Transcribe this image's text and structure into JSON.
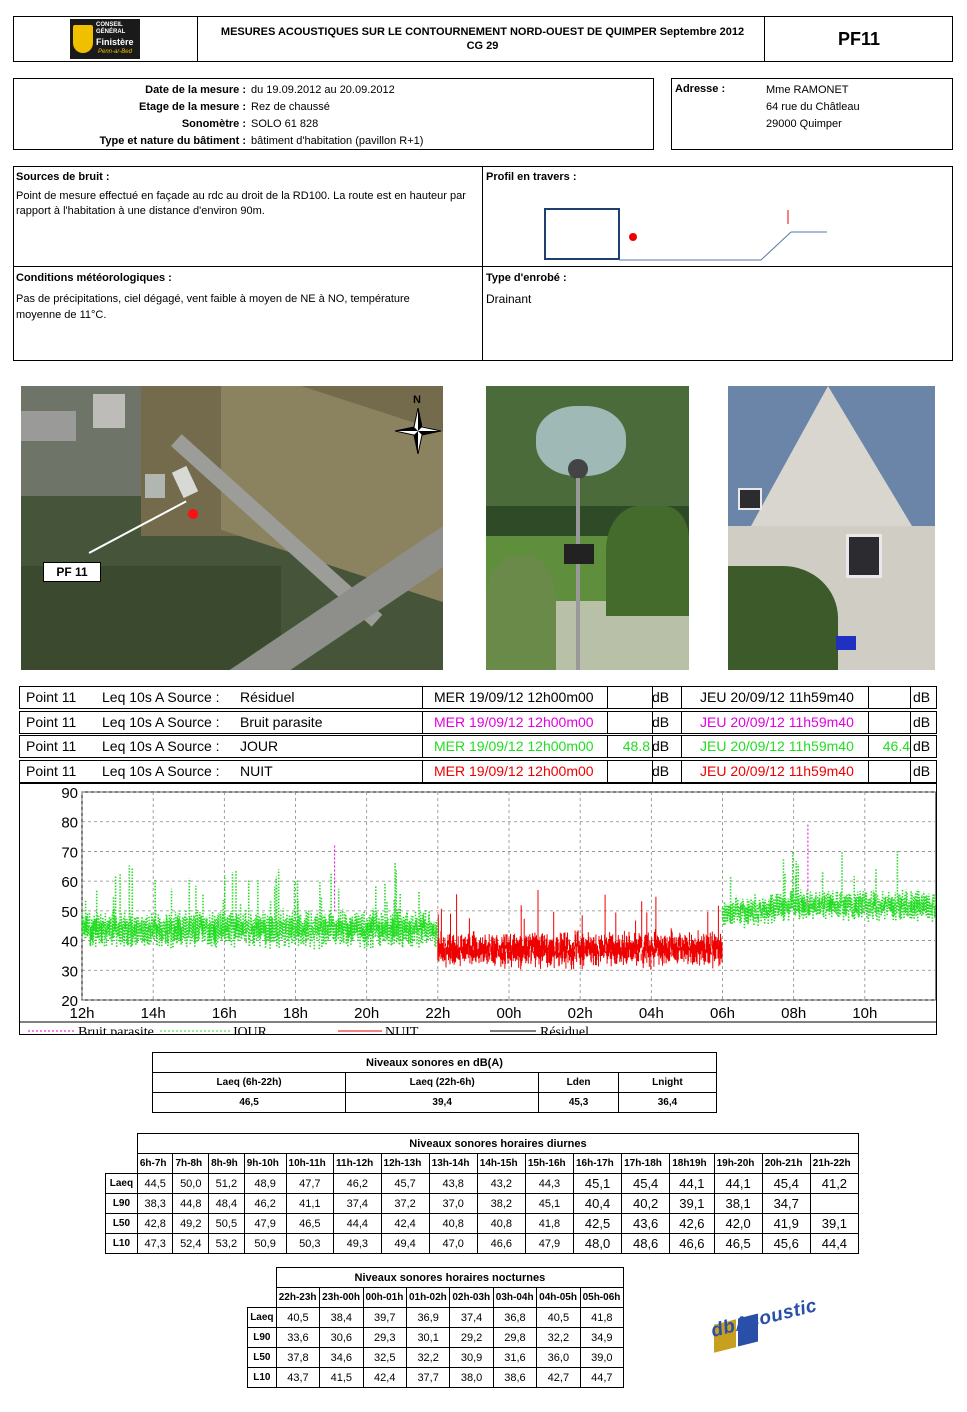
{
  "header": {
    "logo_lines": [
      "CONSEIL",
      "GÉNÉRAL",
      "Finistère",
      "Penn-ar-Bed"
    ],
    "title_line1": "MESURES ACOUSTIQUES SUR LE CONTOURNEMENT NORD-OUEST DE QUIMPER Septembre 2012",
    "title_line2": "CG 29",
    "code": "PF11"
  },
  "info": {
    "labels": [
      "Date de la mesure :",
      "Etage de la mesure :",
      "Sonomètre :",
      "Type et nature du bâtiment :"
    ],
    "values": [
      "du 19.09.2012 au 20.09.2012",
      "Rez de chaussé",
      "SOLO 61 828",
      "bâtiment d'habitation (pavillon R+1)"
    ]
  },
  "address": {
    "label": "Adresse :",
    "lines": [
      "Mme RAMONET",
      "64 rue du Châtleau",
      "29000 Quimper"
    ]
  },
  "sources": {
    "label": "Sources de bruit :",
    "text": "Point de mesure effectué en façade au rdc au droit de la RD100. La route est en hauteur par rapport à l'habitation à une distance d'environ 90m."
  },
  "profil": {
    "label": "Profil en travers :"
  },
  "meteo": {
    "label": "Conditions météorologiques :",
    "text": "Pas de précipitations, ciel dégagé, vent faible à moyen de NE à NO, température moyenne de 11°C."
  },
  "enrobe": {
    "label": "Type d'enrobé :",
    "value": "Drainant"
  },
  "map": {
    "label": "PF 11",
    "north": "N"
  },
  "source_rows": [
    {
      "point": "Point 11",
      "measure": "Leq 10s  A  Source :",
      "name": "Résiduel",
      "start": "MER  19/09/12 12h00m00",
      "val1": "",
      "unit1": "dB",
      "end": "JEU  20/09/12 11h59m40",
      "val2": "",
      "unit2": "dB",
      "color": "#000000"
    },
    {
      "point": "Point 11",
      "measure": "Leq 10s  A  Source :",
      "name": "Bruit parasite",
      "start": "MER  19/09/12 12h00m00",
      "val1": "",
      "unit1": "dB",
      "end": "JEU  20/09/12 11h59m40",
      "val2": "",
      "unit2": "dB",
      "color": "#e000e0"
    },
    {
      "point": "Point 11",
      "measure": "Leq 10s  A  Source :",
      "name": "JOUR",
      "start": "MER  19/09/12 12h00m00",
      "val1": "48.8",
      "unit1": "dB",
      "end": "JEU  20/09/12 11h59m40",
      "val2": "46.4",
      "unit2": "dB",
      "color": "#22dd22"
    },
    {
      "point": "Point 11",
      "measure": "Leq 10s  A  Source :",
      "name": "NUIT",
      "start": "MER  19/09/12 12h00m00",
      "val1": "",
      "unit1": "dB",
      "end": "JEU  20/09/12 11h59m40",
      "val2": "",
      "unit2": "dB",
      "color": "#ee0000"
    }
  ],
  "chart_data": {
    "type": "line",
    "y_ticks": [
      "90",
      "80",
      "70",
      "60",
      "50",
      "40",
      "30",
      "20"
    ],
    "ylim": [
      20,
      90
    ],
    "x_ticks": [
      "12h",
      "14h",
      "16h",
      "18h",
      "20h",
      "22h",
      "00h",
      "02h",
      "04h",
      "06h",
      "08h",
      "10h"
    ],
    "xlim_hours": [
      12,
      36
    ],
    "grid": true,
    "legend_position": "bottom",
    "series": [
      {
        "name": "Bruit parasite",
        "color": "#e000e0",
        "peaks": [
          {
            "t": 19.1,
            "v": 72
          },
          {
            "t": 32.4,
            "v": 79
          }
        ]
      },
      {
        "name": "JOUR",
        "color": "#22dd22",
        "segments": [
          {
            "t_start": 12,
            "t_end": 22,
            "mean": 44,
            "spread": 5
          },
          {
            "t_start": 30,
            "t_end": 36,
            "mean": 49,
            "spread": 4
          }
        ]
      },
      {
        "name": "NUIT",
        "color": "#ee0000",
        "segments": [
          {
            "t_start": 22,
            "t_end": 30,
            "mean": 37,
            "spread": 5
          }
        ]
      },
      {
        "name": "Résiduel",
        "color": "#000000"
      }
    ]
  },
  "levels_table": {
    "title": "Niveaux sonores en dB(A)",
    "headers": [
      "Laeq (6h-22h)",
      "Laeq (22h-6h)",
      "Lden",
      "Lnight"
    ],
    "values": [
      "46,5",
      "39,4",
      "45,3",
      "36,4"
    ]
  },
  "day_table": {
    "title": "Niveaux sonores horaires diurnes",
    "hours": [
      "6h-7h",
      "7h-8h",
      "8h-9h",
      "9h-10h",
      "10h-11h",
      "11h-12h",
      "12h-13h",
      "13h-14h",
      "14h-15h",
      "15h-16h",
      "16h-17h",
      "17h-18h",
      "18h19h",
      "19h-20h",
      "20h-21h",
      "21h-22h"
    ],
    "rows": [
      {
        "label": "Laeq",
        "values": [
          "44,5",
          "50,0",
          "51,2",
          "48,9",
          "47,7",
          "46,2",
          "45,7",
          "43,8",
          "43,2",
          "44,3",
          "45,1",
          "45,4",
          "44,1",
          "44,1",
          "45,4",
          "41,2"
        ]
      },
      {
        "label": "L90",
        "values": [
          "38,3",
          "44,8",
          "48,4",
          "46,2",
          "41,1",
          "37,4",
          "37,2",
          "37,0",
          "38,2",
          "45,1",
          "40,4",
          "40,2",
          "39,1",
          "38,1",
          "34,7"
        ]
      },
      {
        "label": "L50",
        "values": [
          "42,8",
          "49,2",
          "50,5",
          "47,9",
          "46,5",
          "44,4",
          "42,4",
          "40,8",
          "40,8",
          "41,8",
          "42,5",
          "43,6",
          "42,6",
          "42,0",
          "41,9",
          "39,1"
        ]
      },
      {
        "label": "L10",
        "values": [
          "47,3",
          "52,4",
          "53,2",
          "50,9",
          "50,3",
          "49,3",
          "49,4",
          "47,0",
          "46,6",
          "47,9",
          "48,0",
          "48,6",
          "46,6",
          "46,5",
          "45,6",
          "44,4"
        ]
      }
    ]
  },
  "night_table": {
    "title": "Niveaux sonores horaires nocturnes",
    "hours": [
      "22h-23h",
      "23h-00h",
      "00h-01h",
      "01h-02h",
      "02h-03h",
      "03h-04h",
      "04h-05h",
      "05h-06h"
    ],
    "rows": [
      {
        "label": "Laeq",
        "values": [
          "40,5",
          "38,4",
          "39,7",
          "36,9",
          "37,4",
          "36,8",
          "40,5",
          "41,8"
        ]
      },
      {
        "label": "L90",
        "values": [
          "33,6",
          "30,6",
          "29,3",
          "30,1",
          "29,2",
          "29,8",
          "32,2",
          "34,9"
        ]
      },
      {
        "label": "L50",
        "values": [
          "37,8",
          "34,6",
          "32,5",
          "32,2",
          "30,9",
          "31,6",
          "36,0",
          "39,0"
        ]
      },
      {
        "label": "L10",
        "values": [
          "43,7",
          "41,5",
          "42,4",
          "37,7",
          "38,0",
          "38,6",
          "42,7",
          "44,7"
        ]
      }
    ]
  },
  "brand": {
    "text": "dbAcoustic"
  }
}
